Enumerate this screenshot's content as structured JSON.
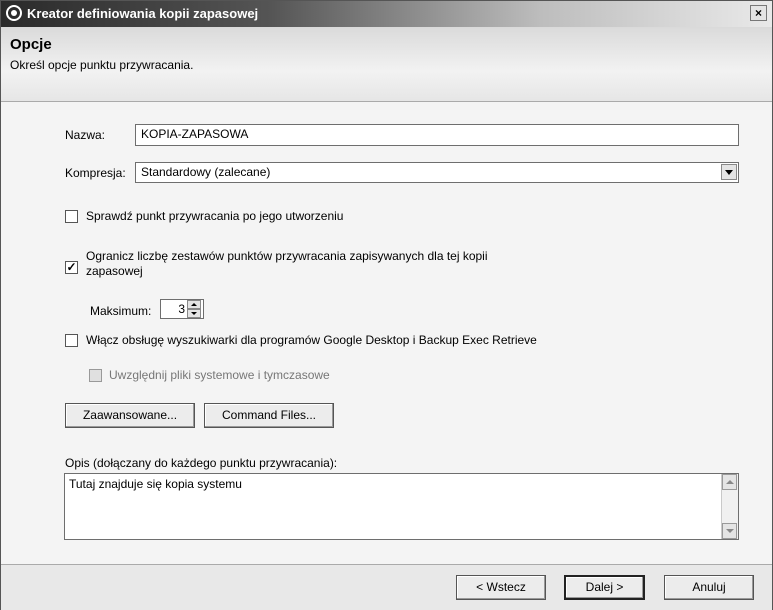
{
  "window": {
    "title": "Kreator definiowania kopii zapasowej",
    "close_label": "×"
  },
  "header": {
    "title": "Opcje",
    "subtitle": "Określ opcje punktu przywracania."
  },
  "form": {
    "name_label": "Nazwa:",
    "name_value": "KOPIA-ZAPASOWA",
    "compression_label": "Kompresja:",
    "compression_value": "Standardowy (zalecane)",
    "verify_label": "Sprawdź punkt przywracania po jego utworzeniu",
    "verify_checked": false,
    "limit_label_line1": "Ogranicz liczbę zestawów punktów przywracania zapisywanych dla tej kopii",
    "limit_label_line2": "zapasowej",
    "limit_checked": true,
    "limit_mark": "✓",
    "maximum_label": "Maksimum:",
    "maximum_value": "3",
    "search_label": "Włącz obsługę wyszukiwarki dla programów Google Desktop i Backup Exec Retrieve",
    "search_checked": false,
    "include_files_label": "Uwzględnij pliki systemowe i tymczasowe",
    "include_files_checked": false,
    "include_files_disabled": true,
    "advanced_button": "Zaawansowane...",
    "command_files_button": "Command Files...",
    "description_label": "Opis (dołączany do każdego punktu przywracania):",
    "description_value": "Tutaj znajduje się kopia systemu"
  },
  "footer": {
    "back_button": "< Wstecz",
    "next_button": "Dalej >",
    "cancel_button": "Anuluj"
  }
}
